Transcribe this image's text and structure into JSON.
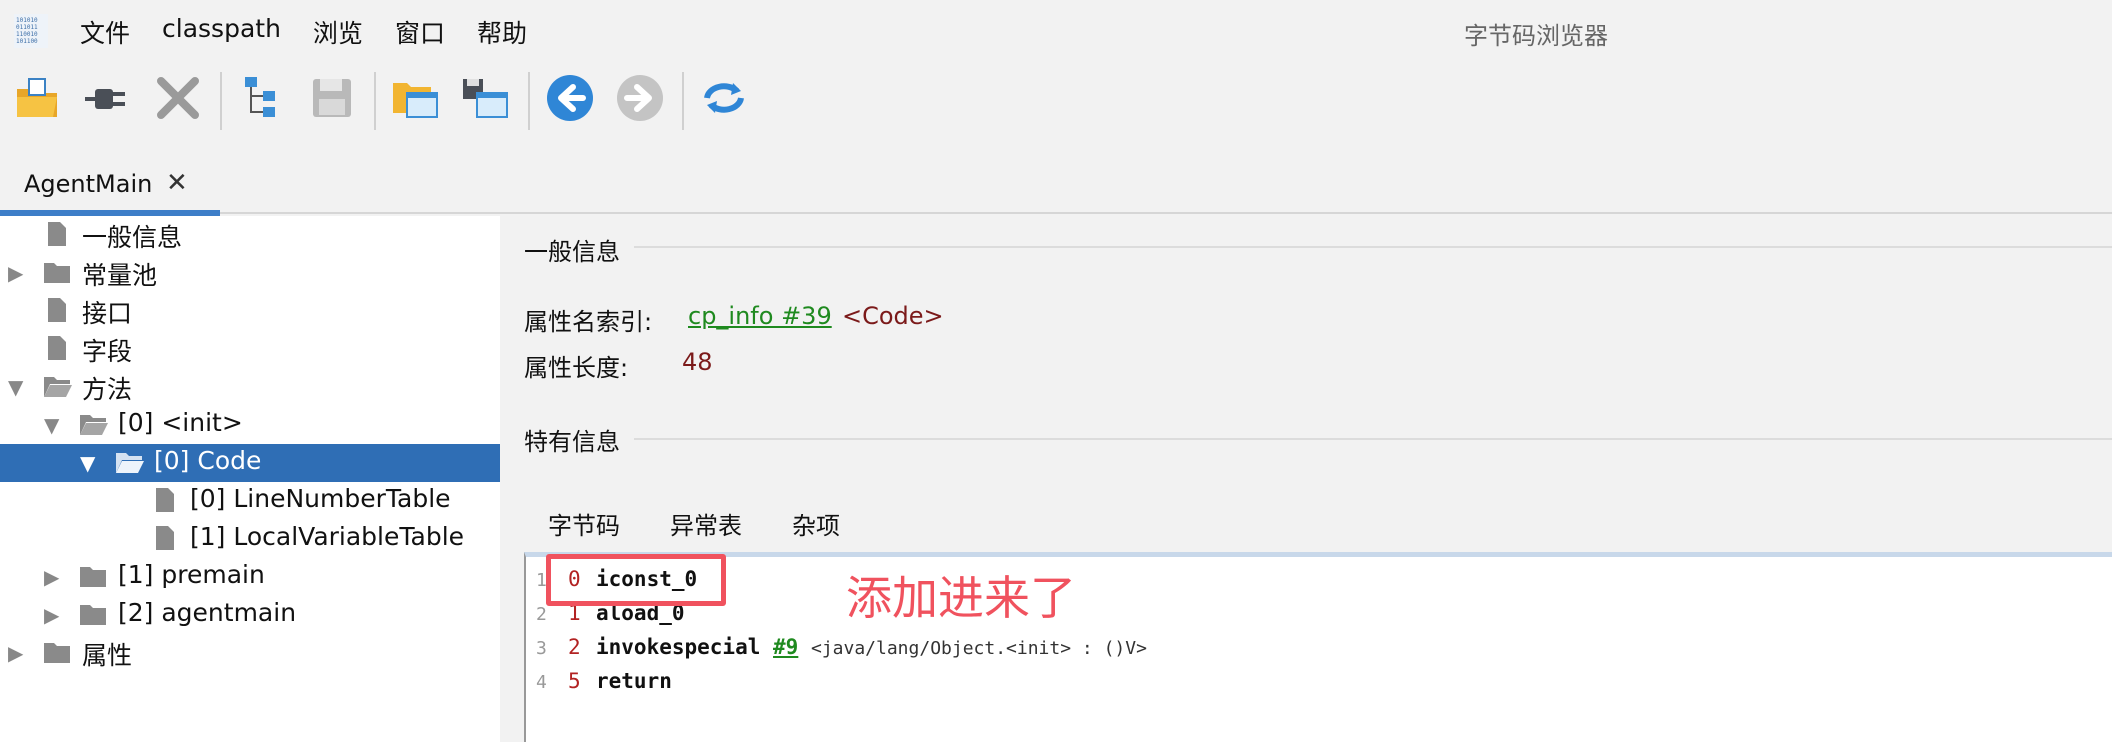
{
  "menubar": {
    "items": [
      "文件",
      "classpath",
      "浏览",
      "窗口",
      "帮助"
    ],
    "window_title": "字节码浏览器"
  },
  "toolbar": {
    "icons": [
      "open-folder-icon",
      "plug-icon",
      "close-x-icon",
      "tree-icon",
      "save-disk-icon",
      "folder-window-icon",
      "save-window-icon",
      "back-arrow-icon",
      "forward-arrow-icon",
      "refresh-icon"
    ]
  },
  "tabs": [
    {
      "label": "AgentMain",
      "close": "✕"
    }
  ],
  "tree": {
    "items": [
      {
        "label": "一般信息",
        "type": "file"
      },
      {
        "label": "常量池",
        "type": "folder",
        "arrow": "▶"
      },
      {
        "label": "接口",
        "type": "file"
      },
      {
        "label": "字段",
        "type": "file"
      },
      {
        "label": "方法",
        "type": "folder-open",
        "arrow": "▼"
      },
      {
        "label": "[0] <init>",
        "type": "folder-open",
        "arrow": "▼"
      },
      {
        "label": "[0] Code",
        "type": "folder-open",
        "arrow": "▼",
        "selected": true
      },
      {
        "label": "[0] LineNumberTable",
        "type": "file"
      },
      {
        "label": "[1] LocalVariableTable",
        "type": "file"
      },
      {
        "label": "[1] premain",
        "type": "folder",
        "arrow": "▶"
      },
      {
        "label": "[2] agentmain",
        "type": "folder",
        "arrow": "▶"
      },
      {
        "label": "属性",
        "type": "folder",
        "arrow": "▶"
      }
    ]
  },
  "general": {
    "title": "一般信息",
    "name_index_label": "属性名索引:",
    "name_index_link": "cp_info #39",
    "name_index_value": "<Code>",
    "length_label": "属性长度:",
    "length_value": "48"
  },
  "specific": {
    "title": "特有信息",
    "subtabs": [
      "字节码",
      "异常表",
      "杂项"
    ]
  },
  "bytecode": [
    {
      "line": "1",
      "offset": "0",
      "op": "iconst_0",
      "ref": "",
      "comment": ""
    },
    {
      "line": "2",
      "offset": "1",
      "op": "aload_0",
      "ref": "",
      "comment": ""
    },
    {
      "line": "3",
      "offset": "2",
      "op": "invokespecial",
      "ref": "#9",
      "comment": "<java/lang/Object.<init> : ()V>"
    },
    {
      "line": "4",
      "offset": "5",
      "op": "return",
      "ref": "",
      "comment": ""
    }
  ],
  "annotation": {
    "text": "添加进来了",
    "color": "#f0525e"
  }
}
